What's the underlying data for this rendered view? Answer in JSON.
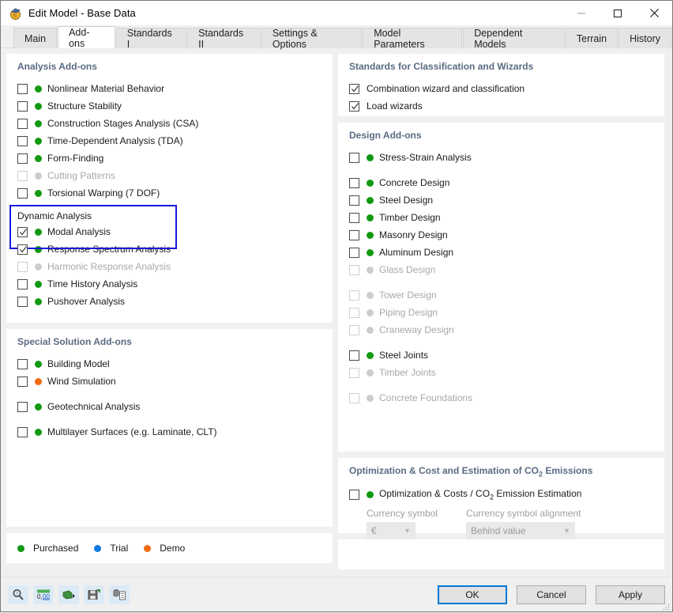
{
  "window": {
    "title": "Edit Model - Base Data",
    "icon": "app-model-icon",
    "controls": {
      "minimize": "–",
      "maximize": "□",
      "close": "✕"
    }
  },
  "tabs": [
    {
      "label": "Main",
      "active": false
    },
    {
      "label": "Add-ons",
      "active": true
    },
    {
      "label": "Standards I",
      "active": false
    },
    {
      "label": "Standards II",
      "active": false
    },
    {
      "label": "Settings & Options",
      "active": false
    },
    {
      "label": "Model Parameters",
      "active": false
    },
    {
      "label": "Dependent Models",
      "active": false
    },
    {
      "label": "Terrain",
      "active": false
    },
    {
      "label": "History",
      "active": false
    }
  ],
  "left": {
    "analysis": {
      "title": "Analysis Add-ons",
      "items": [
        {
          "label": "Nonlinear Material Behavior",
          "checked": false,
          "status": "green",
          "disabled": false
        },
        {
          "label": "Structure Stability",
          "checked": false,
          "status": "green",
          "disabled": false
        },
        {
          "label": "Construction Stages Analysis (CSA)",
          "checked": false,
          "status": "green",
          "disabled": false
        },
        {
          "label": "Time-Dependent Analysis (TDA)",
          "checked": false,
          "status": "green",
          "disabled": false
        },
        {
          "label": "Form-Finding",
          "checked": false,
          "status": "green",
          "disabled": false
        },
        {
          "label": "Cutting Patterns",
          "checked": false,
          "status": "grey",
          "disabled": true
        },
        {
          "label": "Torsional Warping (7 DOF)",
          "checked": false,
          "status": "green",
          "disabled": false
        }
      ],
      "dynamic_group_label": "Dynamic Analysis",
      "dynamic_items": [
        {
          "label": "Modal Analysis",
          "checked": true,
          "status": "green",
          "disabled": false
        },
        {
          "label": "Response Spectrum Analysis",
          "checked": true,
          "status": "green",
          "disabled": false
        },
        {
          "label": "Harmonic Response Analysis",
          "checked": false,
          "status": "grey",
          "disabled": true
        },
        {
          "label": "Time History Analysis",
          "checked": false,
          "status": "green",
          "disabled": false
        },
        {
          "label": "Pushover Analysis",
          "checked": false,
          "status": "green",
          "disabled": false
        }
      ],
      "highlight_color": "#1818dd"
    },
    "special": {
      "title": "Special Solution Add-ons",
      "items": [
        {
          "label": "Building Model",
          "checked": false,
          "status": "green",
          "disabled": false,
          "gap": false
        },
        {
          "label": "Wind Simulation",
          "checked": false,
          "status": "orange",
          "disabled": false,
          "gap": false
        },
        {
          "label": "Geotechnical Analysis",
          "checked": false,
          "status": "green",
          "disabled": false,
          "gap": true
        },
        {
          "label": "Multilayer Surfaces (e.g. Laminate, CLT)",
          "checked": false,
          "status": "green",
          "disabled": false,
          "gap": true
        }
      ]
    },
    "legend": [
      {
        "label": "Purchased",
        "status": "green"
      },
      {
        "label": "Trial",
        "status": "blue"
      },
      {
        "label": "Demo",
        "status": "orange"
      }
    ]
  },
  "right": {
    "standards": {
      "title": "Standards for Classification and Wizards",
      "items": [
        {
          "label": "Combination wizard and classification",
          "checked": true
        },
        {
          "label": "Load wizards",
          "checked": true
        }
      ]
    },
    "design": {
      "title": "Design Add-ons",
      "items": [
        {
          "label": "Stress-Strain Analysis",
          "checked": false,
          "status": "green",
          "disabled": false,
          "gap": false
        },
        {
          "label": "Concrete Design",
          "checked": false,
          "status": "green",
          "disabled": false,
          "gap": true
        },
        {
          "label": "Steel Design",
          "checked": false,
          "status": "green",
          "disabled": false,
          "gap": false
        },
        {
          "label": "Timber Design",
          "checked": false,
          "status": "green",
          "disabled": false,
          "gap": false
        },
        {
          "label": "Masonry Design",
          "checked": false,
          "status": "green",
          "disabled": false,
          "gap": false
        },
        {
          "label": "Aluminum Design",
          "checked": false,
          "status": "green",
          "disabled": false,
          "gap": false
        },
        {
          "label": "Glass Design",
          "checked": false,
          "status": "grey",
          "disabled": true,
          "gap": false
        },
        {
          "label": "Tower Design",
          "checked": false,
          "status": "grey",
          "disabled": true,
          "gap": true
        },
        {
          "label": "Piping Design",
          "checked": false,
          "status": "grey",
          "disabled": true,
          "gap": false
        },
        {
          "label": "Craneway Design",
          "checked": false,
          "status": "grey",
          "disabled": true,
          "gap": false
        },
        {
          "label": "Steel Joints",
          "checked": false,
          "status": "green",
          "disabled": false,
          "gap": true
        },
        {
          "label": "Timber Joints",
          "checked": false,
          "status": "grey",
          "disabled": true,
          "gap": false
        },
        {
          "label": "Concrete Foundations",
          "checked": false,
          "status": "grey",
          "disabled": true,
          "gap": true
        }
      ]
    },
    "optimization": {
      "title_before": "Optimization & Cost and Estimation of CO",
      "title_sub": "2",
      "title_after": " Emissions",
      "checkbox_label_before": "Optimization & Costs / CO",
      "checkbox_label_sub": "2",
      "checkbox_label_after": " Emission Estimation",
      "checked": false,
      "status": "green",
      "currency_symbol_label": "Currency symbol",
      "currency_symbol_value": "€",
      "currency_alignment_label": "Currency symbol alignment",
      "currency_alignment_value": "Behind value"
    }
  },
  "bottom": {
    "tools": [
      {
        "name": "search-magnifier-icon"
      },
      {
        "name": "number-format-icon"
      },
      {
        "name": "export-icon"
      },
      {
        "name": "save-icon"
      },
      {
        "name": "copy-from-model-icon"
      }
    ],
    "buttons": {
      "ok": "OK",
      "cancel": "Cancel",
      "apply": "Apply"
    }
  }
}
